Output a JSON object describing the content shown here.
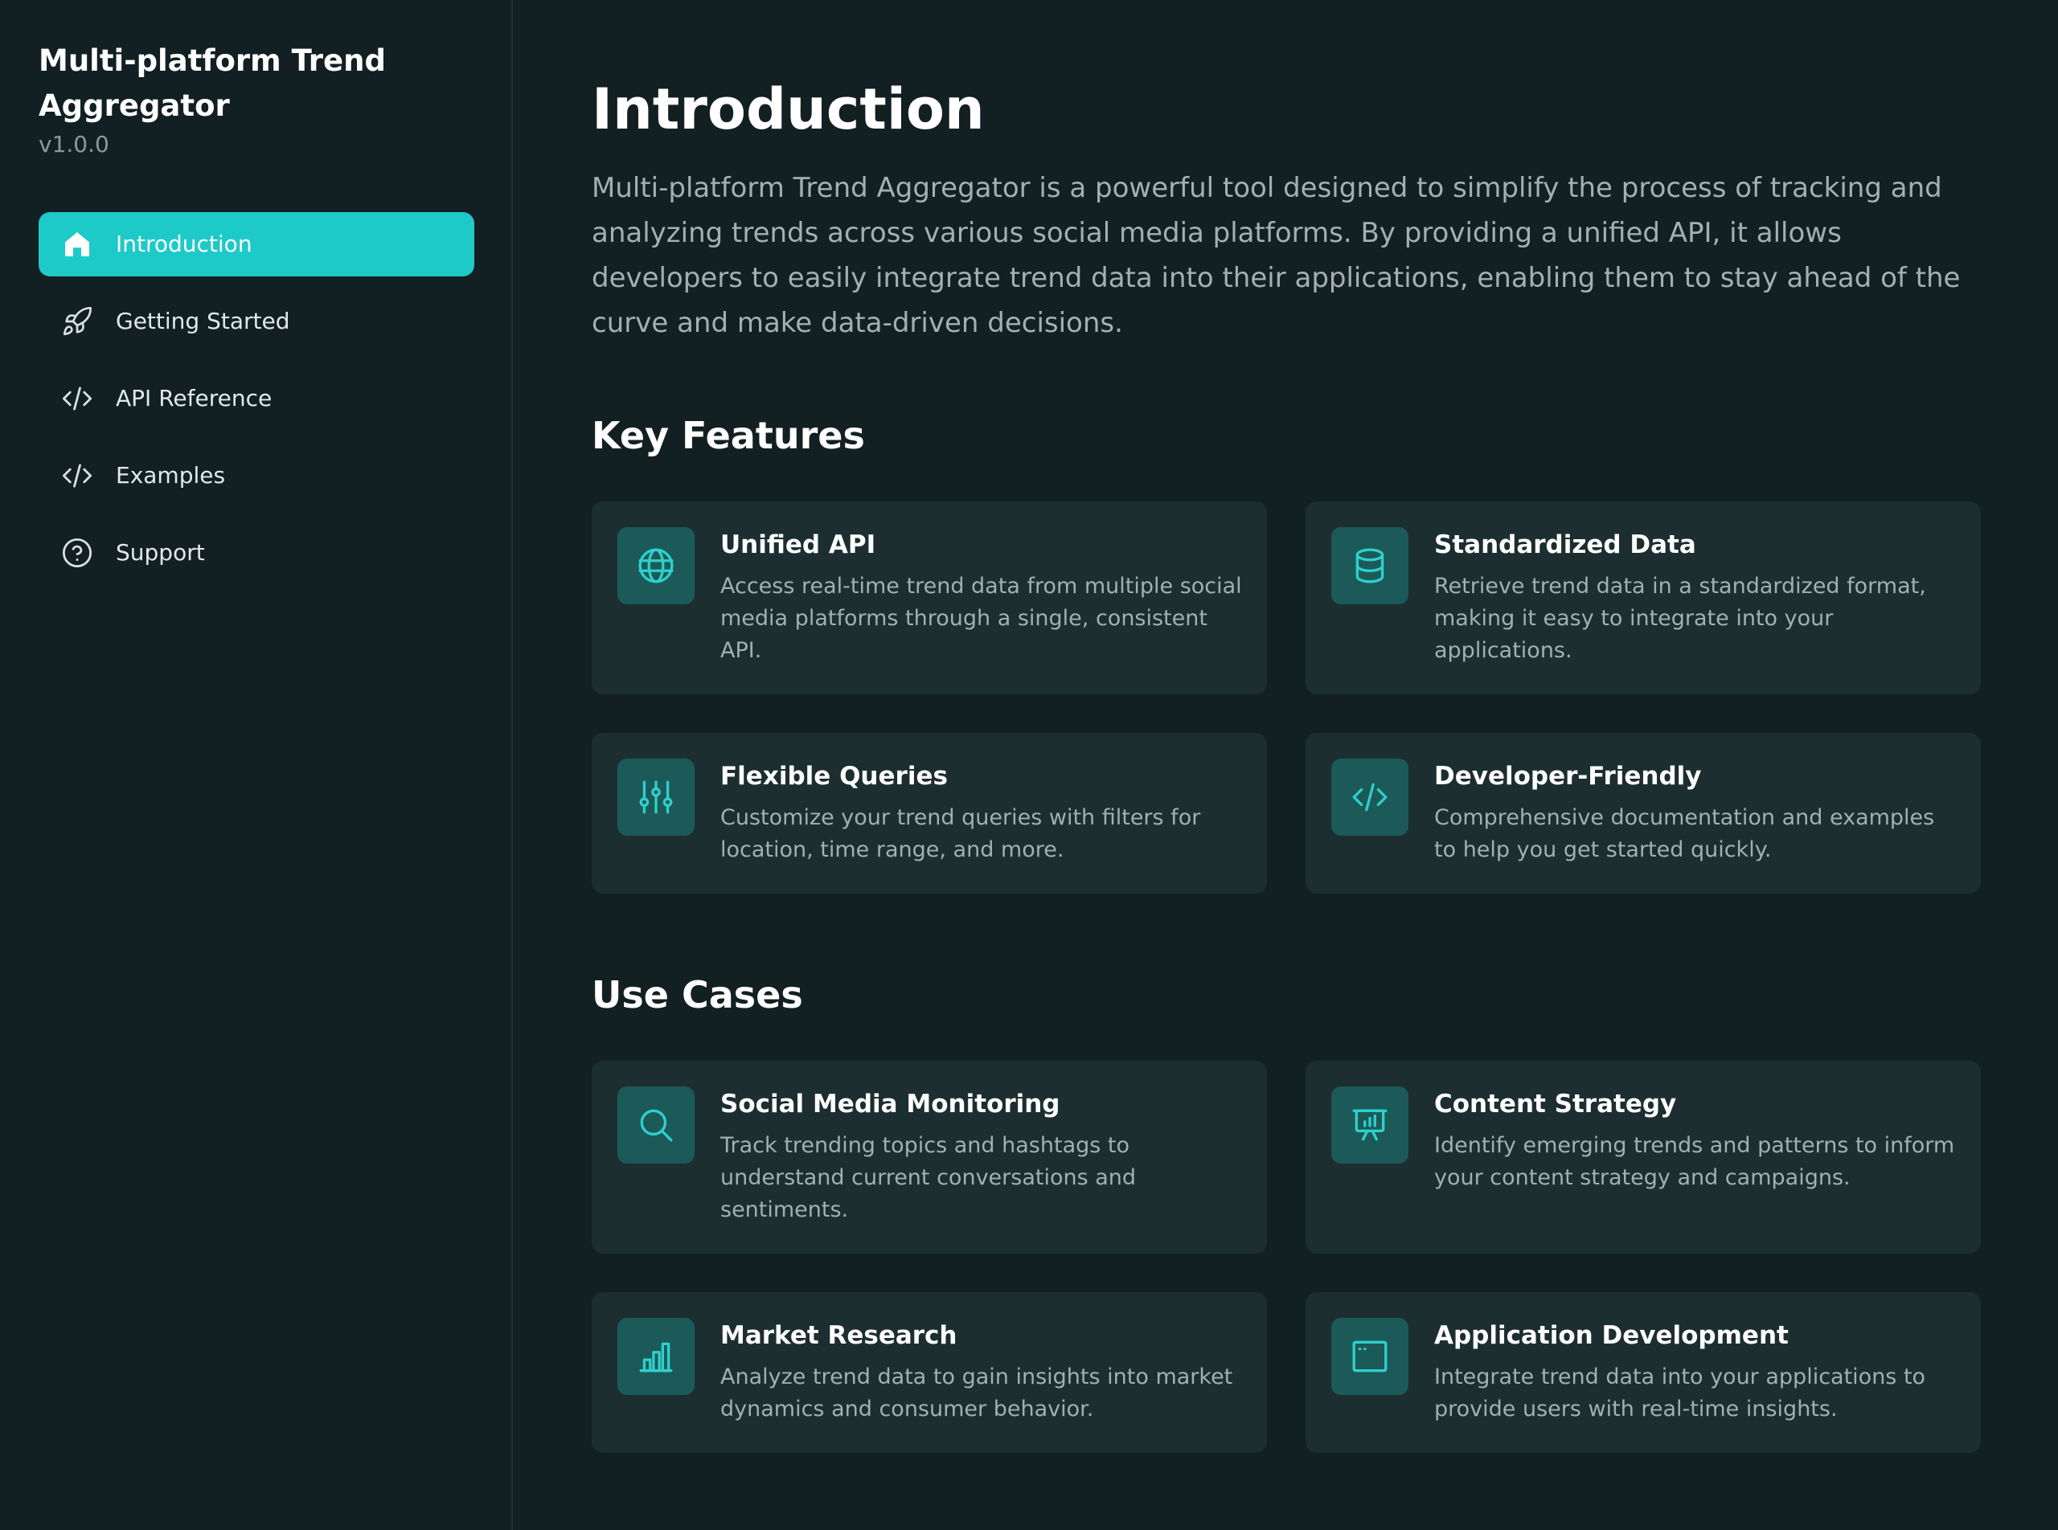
{
  "sidebar": {
    "app_title": "Multi-platform Trend Aggregator",
    "version": "v1.0.0",
    "items": [
      {
        "label": "Introduction",
        "icon": "home-icon",
        "active": true
      },
      {
        "label": "Getting Started",
        "icon": "rocket-icon",
        "active": false
      },
      {
        "label": "API Reference",
        "icon": "code-icon",
        "active": false
      },
      {
        "label": "Examples",
        "icon": "code-icon",
        "active": false
      },
      {
        "label": "Support",
        "icon": "help-circle-icon",
        "active": false
      }
    ]
  },
  "main": {
    "title": "Introduction",
    "intro": "Multi-platform Trend Aggregator is a powerful tool designed to simplify the process of tracking and analyzing trends across various social media platforms. By providing a unified API, it allows developers to easily integrate trend data into their applications, enabling them to stay ahead of the curve and make data-driven decisions.",
    "key_features": {
      "title": "Key Features",
      "cards": [
        {
          "title": "Unified API",
          "description": "Access real-time trend data from multiple social media platforms through a single, consistent API.",
          "icon": "globe-icon"
        },
        {
          "title": "Standardized Data",
          "description": "Retrieve trend data in a standardized format, making it easy to integrate into your applications.",
          "icon": "database-icon"
        },
        {
          "title": "Flexible Queries",
          "description": "Customize your trend queries with filters for location, time range, and more.",
          "icon": "sliders-icon"
        },
        {
          "title": "Developer-Friendly",
          "description": "Comprehensive documentation and examples to help you get started quickly.",
          "icon": "code-icon"
        }
      ]
    },
    "use_cases": {
      "title": "Use Cases",
      "cards": [
        {
          "title": "Social Media Monitoring",
          "description": "Track trending topics and hashtags to understand current conversations and sentiments.",
          "icon": "search-icon"
        },
        {
          "title": "Content Strategy",
          "description": "Identify emerging trends and patterns to inform your content strategy and campaigns.",
          "icon": "presentation-chart-icon"
        },
        {
          "title": "Market Research",
          "description": "Analyze trend data to gain insights into market dynamics and consumer behavior.",
          "icon": "bar-chart-icon"
        },
        {
          "title": "Application Development",
          "description": "Integrate trend data into your applications to provide users with real-time insights.",
          "icon": "app-window-icon"
        }
      ]
    }
  },
  "colors": {
    "background": "#132022",
    "sidebar_background": "#122023",
    "accent": "#1ecac8",
    "card_background": "#1d2e30",
    "icon_tile": "#1b5a58",
    "icon_stroke": "#2fd0cc",
    "text_primary": "#ffffff",
    "text_secondary": "#a3afb1"
  }
}
